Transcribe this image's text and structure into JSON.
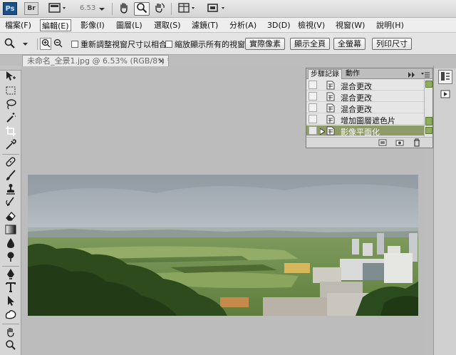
{
  "appbar": {
    "ps_logo": "Ps",
    "br_logo": "Br",
    "zoom": "6.53",
    "icons": {
      "view_extras": "screen-mode-icon",
      "hand": "hand-tool-icon",
      "zoom": "zoom-tool-icon",
      "rotate": "rotate-view-icon",
      "arrange": "arrange-documents-icon",
      "screen": "screen-layout-icon"
    }
  },
  "menu": [
    {
      "label": "檔案(F)"
    },
    {
      "label": "編輯(E)"
    },
    {
      "label": "影像(I)"
    },
    {
      "label": "圖層(L)"
    },
    {
      "label": "選取(S)"
    },
    {
      "label": "濾鏡(T)"
    },
    {
      "label": "分析(A)"
    },
    {
      "label": "3D(D)"
    },
    {
      "label": "檢視(V)"
    },
    {
      "label": "視窗(W)"
    },
    {
      "label": "說明(H)"
    }
  ],
  "options": {
    "resize_windows_label": "重新調整視窗尺寸以相合",
    "zoom_all_label": "縮放顯示所有的視窗",
    "actual_pixels": "實際像素",
    "fit_screen": "顯示全頁",
    "fill_screen": "全螢幕",
    "print_size": "列印尺寸"
  },
  "document": {
    "tab_title": "未命名_全景1.jpg @ 6.53% (RGB/8*) *",
    "close": "×"
  },
  "history": {
    "tabs": [
      {
        "label": "步驟記錄"
      },
      {
        "label": "動作"
      }
    ],
    "rows": [
      {
        "label": "混合更改"
      },
      {
        "label": "混合更改"
      },
      {
        "label": "混合更改"
      },
      {
        "label": "增加圖層遮色片"
      },
      {
        "label": "影像平面化"
      }
    ],
    "selected_index": 4
  },
  "colors": {
    "selected_row": "#8e9c6a",
    "ps_blue": "#1d4f87"
  }
}
